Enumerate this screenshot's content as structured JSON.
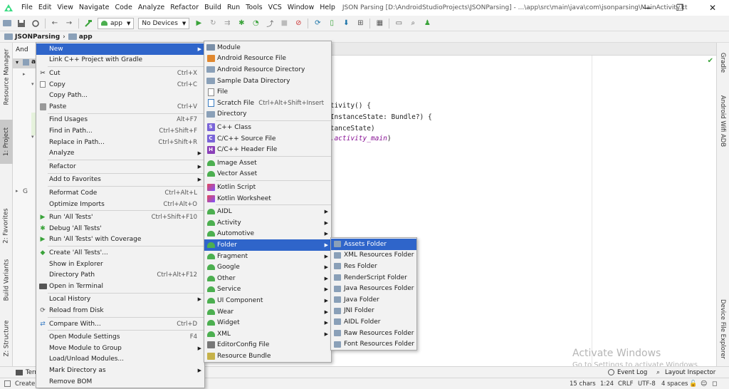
{
  "titlebar": {
    "menu": [
      "File",
      "Edit",
      "View",
      "Navigate",
      "Code",
      "Analyze",
      "Refactor",
      "Build",
      "Run",
      "Tools",
      "VCS",
      "Window",
      "Help"
    ],
    "title": "JSON Parsing [D:\\AndroidStudioProjects\\JSONParsing] - ...\\app\\src\\main\\java\\com\\jsonparsing\\MainActivity.kt",
    "minimize": "—",
    "restore": "❐",
    "close": "✕"
  },
  "toolbar": {
    "module": "app",
    "device": "No Devices"
  },
  "navbar": {
    "project": "JSONParsing",
    "module": "app"
  },
  "left_tabs": {
    "resource_manager": "Resource Manager",
    "project": "1: Project",
    "favorites": "2: Favorites",
    "build_variants": "Build Variants",
    "structure": "Z: Structure"
  },
  "right_tabs": {
    "gradle": "Gradle",
    "wifi_adb": "Android Wifi ADB",
    "file_explorer": "Device File Explorer"
  },
  "project_panel": {
    "header": "And",
    "root": "a",
    "gradle_item": "G"
  },
  "editor": {
    "lines": [
      "ctivity() {",
      "dInstanceState: Bundle?) {",
      "stanceState)"
    ],
    "line4_prefix": "t.",
    "line4_italic": "activity_main",
    "line4_suffix": ")"
  },
  "bottom": {
    "terminal": "Terr",
    "create": "Create a",
    "event_log": "Event Log",
    "layout_inspector": "Layout Inspector"
  },
  "status": {
    "chars": "15 chars",
    "position": "1:24",
    "line_sep": "CRLF",
    "encoding": "UTF-8",
    "indent": "4 spaces"
  },
  "watermark": {
    "title": "Activate Windows",
    "subtitle": "Go to Settings to activate Windows."
  },
  "context_menu": [
    {
      "label": "New",
      "submenu": true,
      "selected": true
    },
    {
      "label": "Link C++ Project with Gradle"
    },
    {
      "sep": true
    },
    {
      "label": "Cut",
      "shortcut": "Ctrl+X",
      "icon": "cut-icon"
    },
    {
      "label": "Copy",
      "shortcut": "Ctrl+C",
      "icon": "copy-icon"
    },
    {
      "label": "Copy Path..."
    },
    {
      "label": "Paste",
      "shortcut": "Ctrl+V",
      "icon": "paste-icon"
    },
    {
      "sep": true
    },
    {
      "label": "Find Usages",
      "shortcut": "Alt+F7"
    },
    {
      "label": "Find in Path...",
      "shortcut": "Ctrl+Shift+F"
    },
    {
      "label": "Replace in Path...",
      "shortcut": "Ctrl+Shift+R"
    },
    {
      "label": "Analyze",
      "submenu": true
    },
    {
      "sep": true
    },
    {
      "label": "Refactor",
      "submenu": true
    },
    {
      "sep": true
    },
    {
      "label": "Add to Favorites",
      "submenu": true
    },
    {
      "sep": true
    },
    {
      "label": "Reformat Code",
      "shortcut": "Ctrl+Alt+L"
    },
    {
      "label": "Optimize Imports",
      "shortcut": "Ctrl+Alt+O"
    },
    {
      "sep": true
    },
    {
      "label": "Run 'All Tests'",
      "shortcut": "Ctrl+Shift+F10",
      "icon": "run-icon"
    },
    {
      "label": "Debug 'All Tests'",
      "icon": "debug-icon"
    },
    {
      "label": "Run 'All Tests' with Coverage",
      "icon": "coverage-icon"
    },
    {
      "sep": true
    },
    {
      "label": "Create 'All Tests'...",
      "icon": "create-test-icon"
    },
    {
      "label": "Show in Explorer"
    },
    {
      "label": "Directory Path",
      "shortcut": "Ctrl+Alt+F12"
    },
    {
      "label": "Open in Terminal",
      "icon": "terminal-icon"
    },
    {
      "sep": true
    },
    {
      "label": "Local History",
      "submenu": true
    },
    {
      "label": "Reload from Disk",
      "icon": "reload-icon"
    },
    {
      "sep": true
    },
    {
      "label": "Compare With...",
      "shortcut": "Ctrl+D",
      "icon": "compare-icon"
    },
    {
      "sep": true
    },
    {
      "label": "Open Module Settings",
      "shortcut": "F4"
    },
    {
      "label": "Move Module to Group",
      "submenu": true
    },
    {
      "label": "Load/Unload Modules..."
    },
    {
      "label": "Mark Directory as",
      "submenu": true
    },
    {
      "label": "Remove BOM"
    }
  ],
  "new_menu": [
    {
      "label": "Module",
      "icon": "module-icon"
    },
    {
      "label": "Android Resource File",
      "icon": "android-resource-file-icon"
    },
    {
      "label": "Android Resource Directory",
      "icon": "folder-icon"
    },
    {
      "label": "Sample Data Directory",
      "icon": "folder-icon"
    },
    {
      "label": "File",
      "icon": "file-icon"
    },
    {
      "label": "Scratch File",
      "shortcut": "Ctrl+Alt+Shift+Insert",
      "icon": "scratch-file-icon"
    },
    {
      "label": "Directory",
      "icon": "folder-icon"
    },
    {
      "sep": true
    },
    {
      "label": "C++ Class",
      "icon": "cpp-class-icon"
    },
    {
      "label": "C/C++ Source File",
      "icon": "cpp-source-icon"
    },
    {
      "label": "C/C++ Header File",
      "icon": "cpp-header-icon"
    },
    {
      "sep": true
    },
    {
      "label": "Image Asset",
      "icon": "android-icon"
    },
    {
      "label": "Vector Asset",
      "icon": "android-icon"
    },
    {
      "sep": true
    },
    {
      "label": "Kotlin Script",
      "icon": "kotlin-icon"
    },
    {
      "label": "Kotlin Worksheet",
      "icon": "kotlin-icon"
    },
    {
      "sep": true
    },
    {
      "label": "AIDL",
      "submenu": true,
      "icon": "android-icon"
    },
    {
      "label": "Activity",
      "submenu": true,
      "icon": "android-icon"
    },
    {
      "label": "Automotive",
      "submenu": true,
      "icon": "android-icon"
    },
    {
      "label": "Folder",
      "submenu": true,
      "selected": true,
      "icon": "android-icon"
    },
    {
      "label": "Fragment",
      "submenu": true,
      "icon": "android-icon"
    },
    {
      "label": "Google",
      "submenu": true,
      "icon": "android-icon"
    },
    {
      "label": "Other",
      "submenu": true,
      "icon": "android-icon"
    },
    {
      "label": "Service",
      "submenu": true,
      "icon": "android-icon"
    },
    {
      "label": "UI Component",
      "submenu": true,
      "icon": "android-icon"
    },
    {
      "label": "Wear",
      "submenu": true,
      "icon": "android-icon"
    },
    {
      "label": "Widget",
      "submenu": true,
      "icon": "android-icon"
    },
    {
      "label": "XML",
      "submenu": true,
      "icon": "android-icon"
    },
    {
      "label": "EditorConfig File",
      "icon": "editorconfig-icon"
    },
    {
      "label": "Resource Bundle",
      "icon": "resource-bundle-icon"
    }
  ],
  "folder_menu": [
    {
      "label": "Assets Folder",
      "selected": true
    },
    {
      "label": "XML Resources Folder"
    },
    {
      "label": "Res Folder"
    },
    {
      "label": "RenderScript Folder"
    },
    {
      "label": "Java Resources Folder"
    },
    {
      "label": "Java Folder"
    },
    {
      "label": "JNI Folder"
    },
    {
      "label": "AIDL Folder"
    },
    {
      "label": "Raw Resources Folder"
    },
    {
      "label": "Font Resources Folder"
    }
  ],
  "colors": {
    "selection": "#2f65ca",
    "menu_bg": "#f2f2f2",
    "android_green": "#4caf50",
    "run_green": "#3aa33a"
  }
}
